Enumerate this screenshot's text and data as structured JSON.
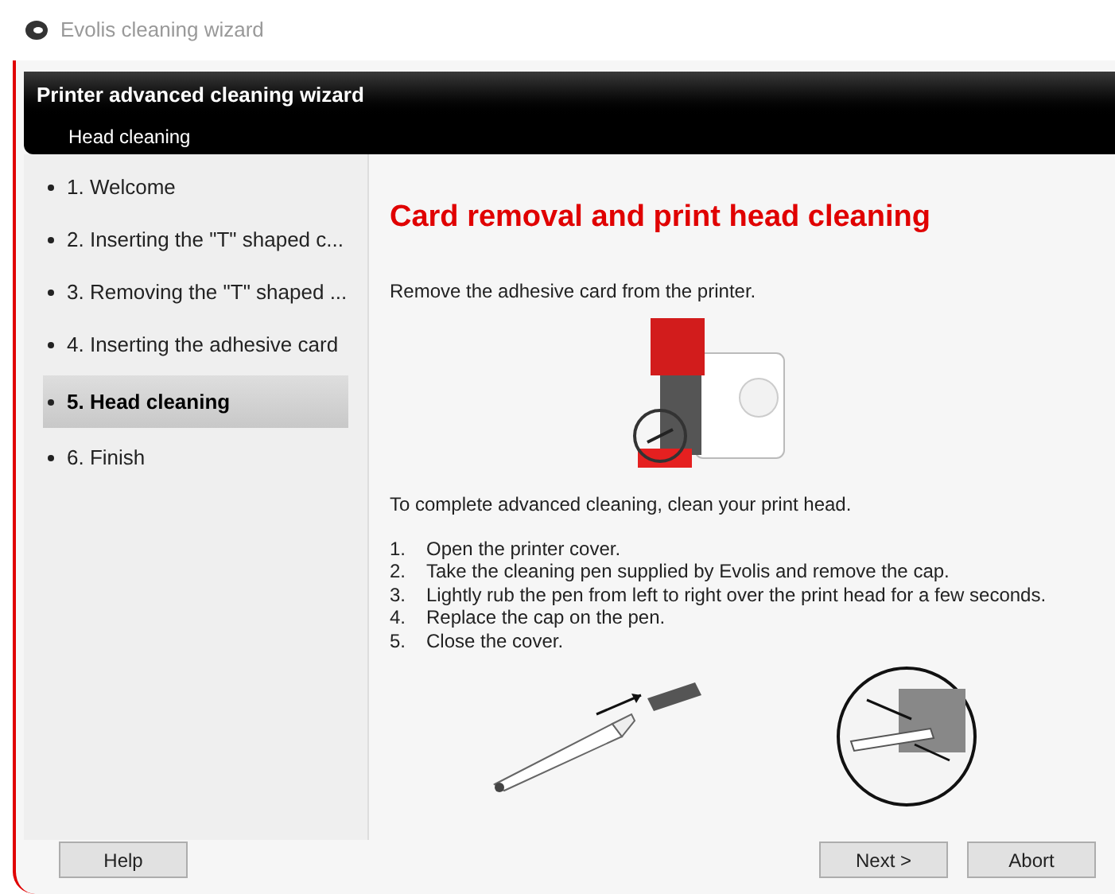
{
  "window": {
    "title": "Evolis cleaning wizard"
  },
  "header": {
    "title": "Printer advanced cleaning wizard",
    "subtitle": "Head cleaning"
  },
  "steps": [
    {
      "label": "1. Welcome",
      "selected": false
    },
    {
      "label": "2. Inserting the \"T\" shaped c...",
      "selected": false
    },
    {
      "label": "3. Removing the \"T\" shaped ...",
      "selected": false
    },
    {
      "label": "4. Inserting the adhesive card",
      "selected": false
    },
    {
      "label": "5. Head cleaning",
      "selected": true
    },
    {
      "label": "6. Finish",
      "selected": false
    }
  ],
  "content": {
    "heading": "Card removal and print head cleaning",
    "intro": "Remove the adhesive card from the printer.",
    "instruction": "To complete advanced cleaning, clean your print head.",
    "list": [
      {
        "number": "1.",
        "text": "Open the printer cover."
      },
      {
        "number": "2.",
        "text": "Take the cleaning pen supplied by Evolis and remove the cap."
      },
      {
        "number": "3.",
        "text": "Lightly rub the pen from left to right over the print head for a few seconds."
      },
      {
        "number": "4.",
        "text": "Replace the cap on the pen."
      },
      {
        "number": "5.",
        "text": "Close the cover."
      }
    ]
  },
  "buttons": {
    "help": "Help",
    "next": "Next >",
    "abort": "Abort"
  }
}
